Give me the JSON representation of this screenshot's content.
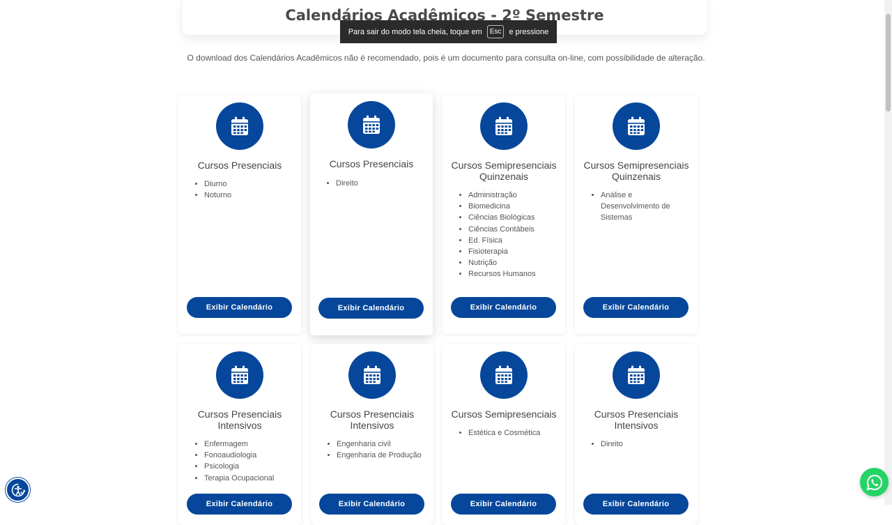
{
  "page_title": "Calendários Acadêmicos - 2º Semestre",
  "fullscreen_toast": {
    "before": "Para sair do modo tela cheia, toque em",
    "key": "Esc",
    "after": "e pressione"
  },
  "notice": "O download dos Calendários Acadêmicos não é recomendado, pois é um documento para consulta on-line, com possibilidade de alteração.",
  "cards": [
    {
      "title": "Cursos Presenciais",
      "items": [
        "Diurno",
        "Noturno"
      ],
      "button": "Exibir Calendário"
    },
    {
      "title": "Cursos Presenciais",
      "items": [
        "Direito"
      ],
      "button": "Exibir Calendário"
    },
    {
      "title": "Cursos Semipresenciais Quinzenais",
      "items": [
        "Administração",
        "Biomedicina",
        "Ciências Biológicas",
        "Ciências Contábeis",
        "Ed. Física",
        "Fisioterapia",
        "Nutrição",
        "Recursos Humanos"
      ],
      "button": "Exibir Calendário"
    },
    {
      "title": "Cursos Semipresenciais Quinzenais",
      "items": [
        "Análise e Desenvolvimento de Sistemas"
      ],
      "button": "Exibir Calendário"
    },
    {
      "title": "Cursos Presenciais Intensivos",
      "items": [
        "Enfermagem",
        "Fonoaudiologia",
        "Psicologia",
        "Terapia Ocupacional"
      ],
      "button": "Exibir Calendário"
    },
    {
      "title": "Cursos Presenciais Intensivos",
      "items": [
        "Engenharia civil",
        "Engenharia de Produção"
      ],
      "button": "Exibir Calendário"
    },
    {
      "title": "Cursos Semipresenciais",
      "items": [
        "Estética e Cosmética"
      ],
      "button": "Exibir Calendário"
    },
    {
      "title": "Cursos Presenciais Intensivos",
      "items": [
        "Direito"
      ],
      "button": "Exibir Calendário"
    }
  ],
  "icons": {
    "card_icon": "calendar-icon",
    "accessibility": "accessibility-icon",
    "chat": "whatsapp-icon"
  },
  "colors": {
    "brand": "#06479b",
    "whatsapp": "#25d366"
  }
}
